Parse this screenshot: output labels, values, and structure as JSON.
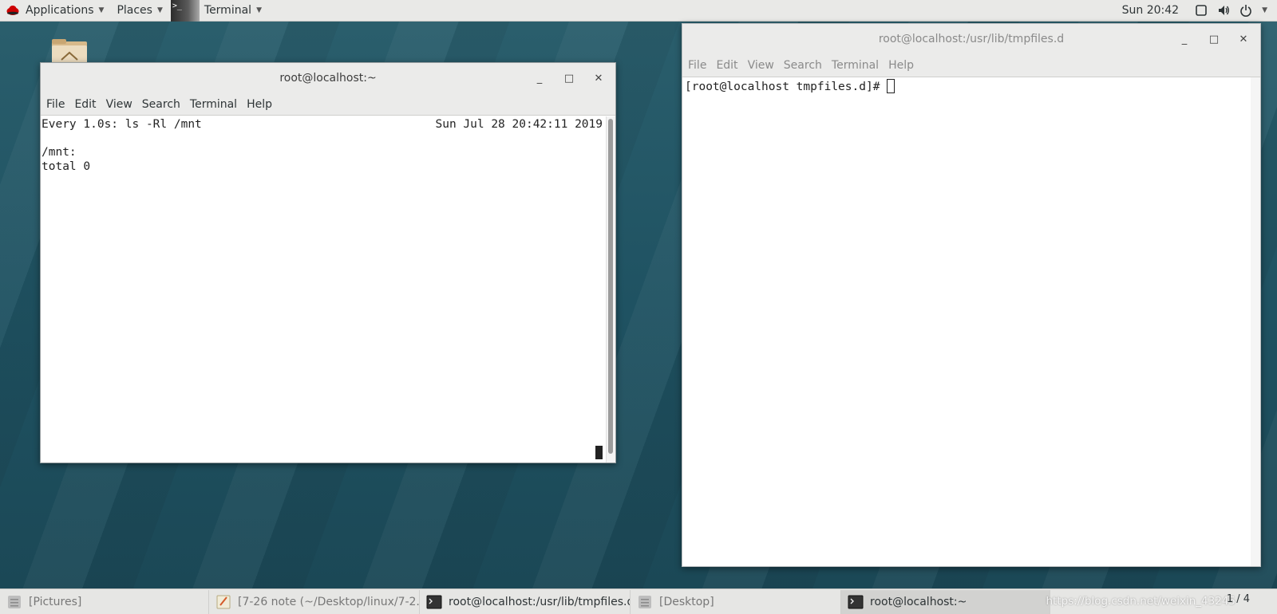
{
  "topbar": {
    "applications": "Applications",
    "places": "Places",
    "terminal": "Terminal",
    "clock": "Sun 20:42"
  },
  "window_left": {
    "title": "root@localhost:~",
    "menu": [
      "File",
      "Edit",
      "View",
      "Search",
      "Terminal",
      "Help"
    ],
    "line1": "Every 1.0s: ls -Rl /mnt",
    "time": "Sun Jul 28 20:42:11 2019",
    "line3": "/mnt:",
    "line4": "total 0"
  },
  "window_right": {
    "title": "root@localhost:/usr/lib/tmpfiles.d",
    "menu": [
      "File",
      "Edit",
      "View",
      "Search",
      "Terminal",
      "Help"
    ],
    "prompt": "[root@localhost tmpfiles.d]# "
  },
  "taskbar": {
    "tasks": [
      "[Pictures]",
      "[7-26 note (~/Desktop/linux/7-2...",
      "root@localhost:/usr/lib/tmpfiles.d",
      "[Desktop]",
      "root@localhost:~"
    ],
    "watermark": "https://blog.csdn.net/weixin_43245",
    "pager": "1 / 4"
  },
  "icons": [
    "redhat-icon",
    "terminal-icon",
    "screen-icon",
    "volume-icon",
    "power-icon",
    "folder-icon",
    "minimize-icon",
    "maximize-icon",
    "close-icon",
    "note-icon"
  ]
}
